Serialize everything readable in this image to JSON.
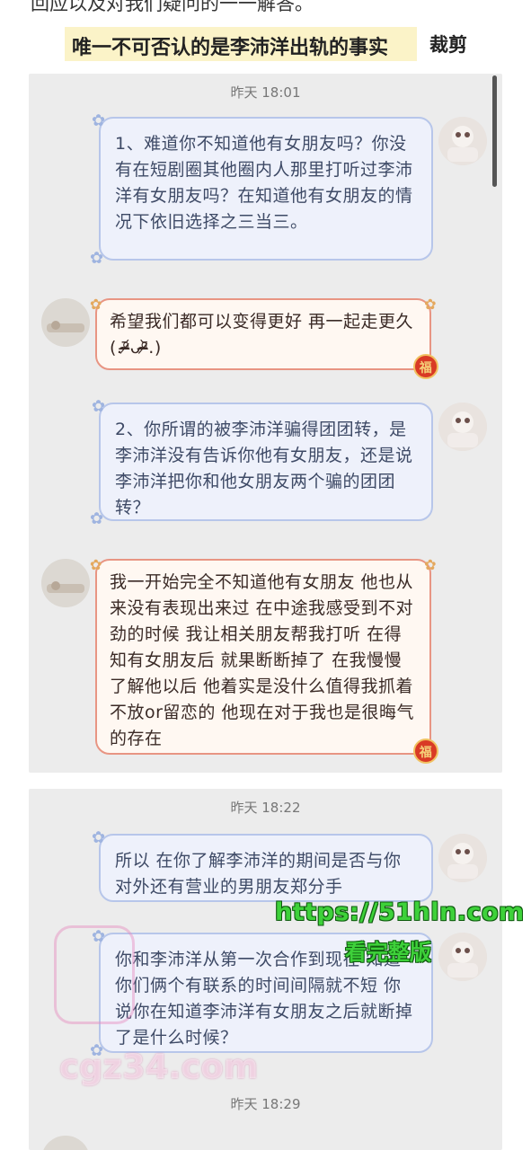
{
  "header": {
    "top_line": "回应以及对我们疑问的一一解答。",
    "highlight_caption": "唯一不可否认的是李沛洋出轨的事实",
    "crop_label": "裁剪"
  },
  "chat": {
    "timestamps": [
      "昨天 18:01",
      "昨天 18:22",
      "昨天 18:29"
    ],
    "messages": [
      {
        "side": "out",
        "text": "1、难道你不知道他有女朋友吗？你没有在短剧圈其他圈内人那里打听过李沛洋有女朋友吗？在知道他有女朋友的情况下依旧选择之三当三。"
      },
      {
        "side": "in",
        "text": "希望我们都可以变得更好 再一起走更久 (.ᵒ̴̶̷᷄ᴗᵒ̴̶̷᷅.)"
      },
      {
        "side": "out",
        "text": "2、你所谓的被李沛洋骗得团团转，是李沛洋没有告诉你他有女朋友，还是说李沛洋把你和他女朋友两个骗的团团转？"
      },
      {
        "side": "in",
        "text": "我一开始完全不知道他有女朋友 他也从来没有表现出来过 在中途我感受到不对劲的时候 我让相关朋友帮我打听 在得知有女朋友后 就果断断掉了 在我慢慢了解他以后 他着实是没什么值得我抓着不放or留恋的 他现在对于我也是很晦气的存在"
      },
      {
        "side": "out",
        "text": "所以 在你了解李沛洋的期间是否与你对外还有营业的男朋友郑分手"
      },
      {
        "side": "out",
        "text": "你和李沛洋从第一次合作到现在 知道你们俩个有联系的时间间隔就不短 你说你在知道李沛洋有女朋友之后就断掉了是什么时候？"
      }
    ],
    "badge_char": "福"
  },
  "watermarks": {
    "url": "https://51hln.com",
    "label": "看完整版",
    "site": "cgz34.com"
  },
  "colors": {
    "panel_bg": "#ececec",
    "out_bubble_bg": "#eef1fb",
    "out_bubble_border": "#b7c6ea",
    "in_bubble_bg": "#fff8f2",
    "in_bubble_border": "#e89583",
    "highlight": "#fbf3c8",
    "watermark_green": "#3ed13a"
  },
  "icons": [
    "avatar-self",
    "avatar-other",
    "fu-badge",
    "flower-deco"
  ]
}
